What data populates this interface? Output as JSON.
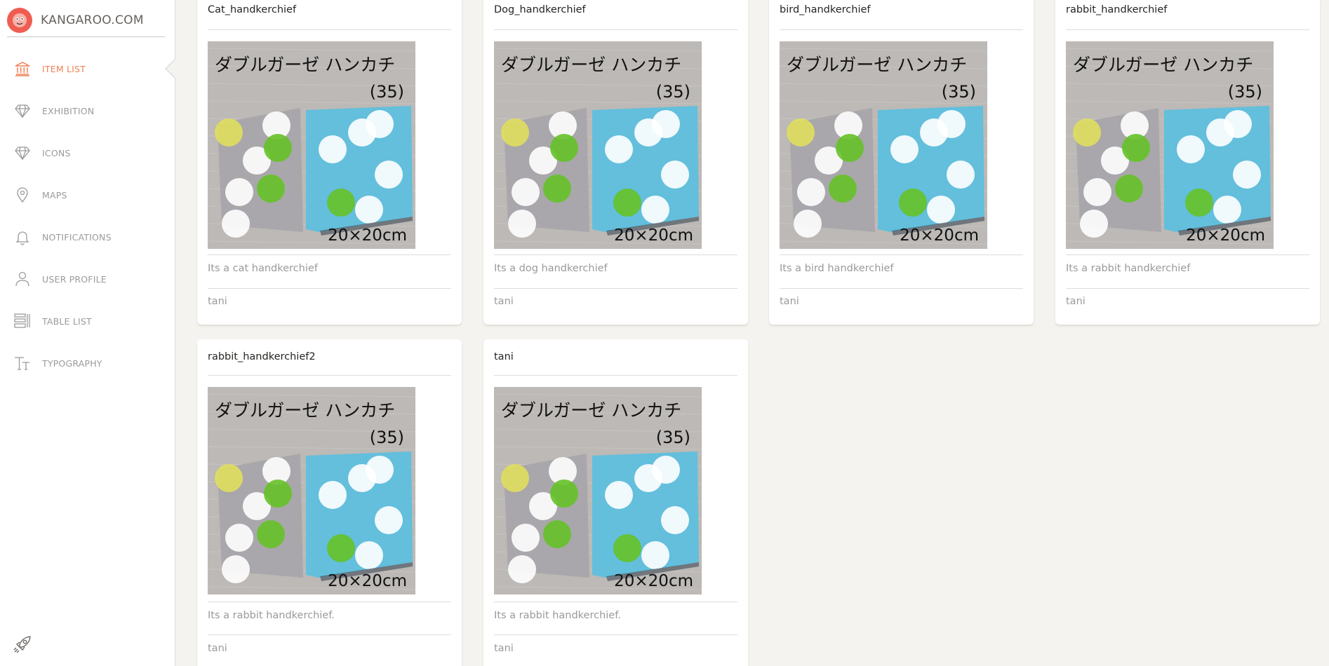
{
  "brand": {
    "name": "KANGAROO.COM"
  },
  "sidebar": {
    "items": [
      {
        "label": "ITEM LIST",
        "icon": "bank-icon",
        "active": true
      },
      {
        "label": "EXHIBITION",
        "icon": "diamond-icon",
        "active": false
      },
      {
        "label": "ICONS",
        "icon": "diamond-icon",
        "active": false
      },
      {
        "label": "MAPS",
        "icon": "pin-icon",
        "active": false
      },
      {
        "label": "NOTIFICATIONS",
        "icon": "bell-icon",
        "active": false
      },
      {
        "label": "USER PROFILE",
        "icon": "user-icon",
        "active": false
      },
      {
        "label": "TABLE LIST",
        "icon": "list-icon",
        "active": false
      },
      {
        "label": "TYPOGRAPHY",
        "icon": "text-icon",
        "active": false
      }
    ]
  },
  "image_text": {
    "top": "ダブルガーゼ ハンカチ",
    "number": "(35)",
    "size": "20×20cm"
  },
  "items": [
    {
      "title": "Cat_handkerchief",
      "description": "Its a cat handkerchief",
      "author": "tani"
    },
    {
      "title": "Dog_handkerchief",
      "description": "Its a dog handkerchief",
      "author": "tani"
    },
    {
      "title": "bird_handkerchief",
      "description": "Its a bird handkerchief",
      "author": "tani"
    },
    {
      "title": "rabbit_handkerchief",
      "description": "Its a rabbit handkerchief",
      "author": "tani"
    },
    {
      "title": "rabbit_handkerchief2",
      "description": "Its a rabbit handkerchief.",
      "author": "tani"
    },
    {
      "title": "tani",
      "description": "Its a rabbit handkerchief.",
      "author": "tani"
    }
  ],
  "colors": {
    "accent": "#ef8157",
    "logo": "#ef5d52",
    "background": "#f4f3ef",
    "muted_text": "#9a9a9a"
  }
}
